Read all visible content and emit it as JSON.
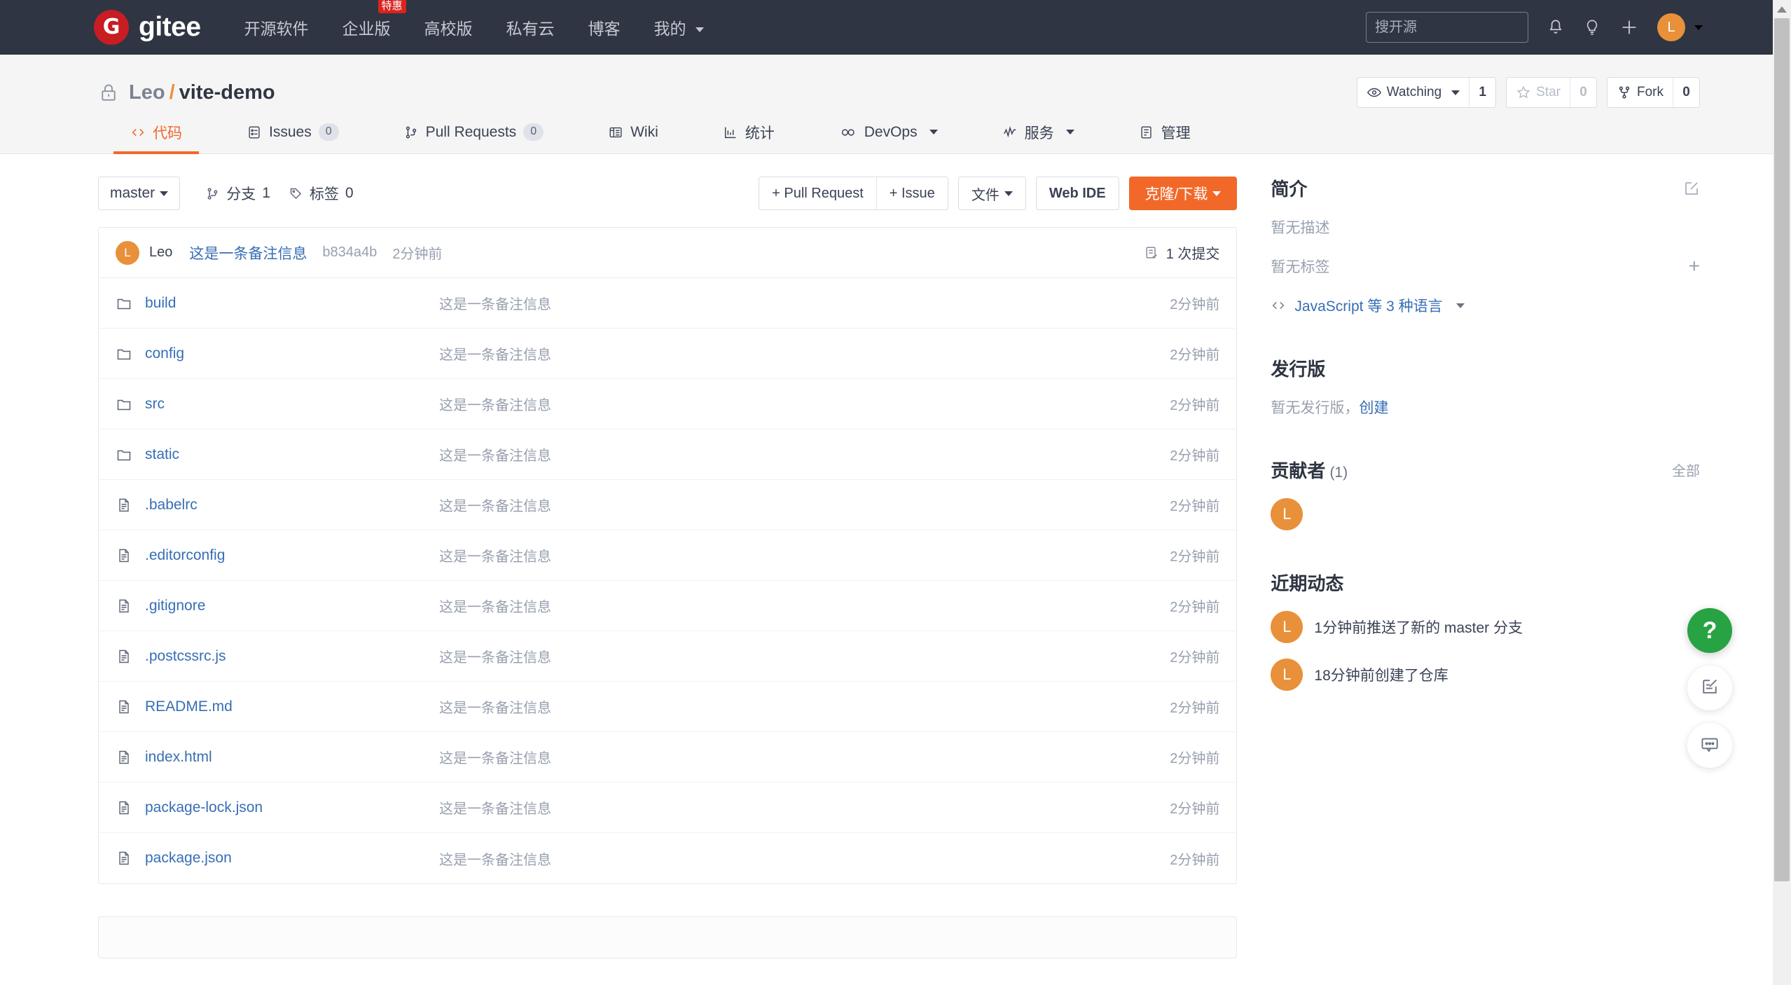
{
  "topnav": {
    "brand_letter": "G",
    "brand_name": "gitee",
    "items": [
      {
        "label": "开源软件",
        "badge": null,
        "caret": false
      },
      {
        "label": "企业版",
        "badge": "特惠",
        "caret": false
      },
      {
        "label": "高校版",
        "badge": null,
        "caret": false
      },
      {
        "label": "私有云",
        "badge": null,
        "caret": false
      },
      {
        "label": "博客",
        "badge": null,
        "caret": false
      },
      {
        "label": "我的",
        "badge": null,
        "caret": true
      }
    ],
    "search_placeholder": "搜开源",
    "search_value": "",
    "avatar_letter": "L"
  },
  "repo": {
    "owner": "Leo",
    "separator": "/",
    "name": "vite-demo",
    "visibility_icon": "lock-icon",
    "watch_label": "Watching",
    "watch_count": "1",
    "star_label": "Star",
    "star_count": "0",
    "fork_label": "Fork",
    "fork_count": "0"
  },
  "tabs": [
    {
      "label": "代码",
      "icon": "code-icon",
      "count": null,
      "active": true,
      "caret": false
    },
    {
      "label": "Issues",
      "icon": "issue-icon",
      "count": "0",
      "active": false,
      "caret": false
    },
    {
      "label": "Pull Requests",
      "icon": "pull-request-icon",
      "count": "0",
      "active": false,
      "caret": false
    },
    {
      "label": "Wiki",
      "icon": "book-icon",
      "count": null,
      "active": false,
      "caret": false
    },
    {
      "label": "统计",
      "icon": "chart-icon",
      "count": null,
      "active": false,
      "caret": false
    },
    {
      "label": "DevOps",
      "icon": "infinity-icon",
      "count": null,
      "active": false,
      "caret": true
    },
    {
      "label": "服务",
      "icon": "pulse-icon",
      "count": null,
      "active": false,
      "caret": true
    },
    {
      "label": "管理",
      "icon": "settings-icon",
      "count": null,
      "active": false,
      "caret": false
    }
  ],
  "toolbar": {
    "branch": "master",
    "branches_label": "分支",
    "branches_count": "1",
    "tags_label": "标签",
    "tags_count": "0",
    "pull_request_label": "+ Pull Request",
    "issue_label": "+ Issue",
    "files_label": "文件",
    "web_ide_label": "Web IDE",
    "clone_label": "克隆/下载"
  },
  "commit": {
    "avatar_letter": "L",
    "author": "Leo",
    "message": "这是一条备注信息",
    "sha": "b834a4b",
    "time": "2分钟前",
    "count_label": "1 次提交"
  },
  "files": [
    {
      "name": "build",
      "type": "folder",
      "message": "这是一条备注信息",
      "time": "2分钟前"
    },
    {
      "name": "config",
      "type": "folder",
      "message": "这是一条备注信息",
      "time": "2分钟前"
    },
    {
      "name": "src",
      "type": "folder",
      "message": "这是一条备注信息",
      "time": "2分钟前"
    },
    {
      "name": "static",
      "type": "folder",
      "message": "这是一条备注信息",
      "time": "2分钟前"
    },
    {
      "name": ".babelrc",
      "type": "file",
      "message": "这是一条备注信息",
      "time": "2分钟前"
    },
    {
      "name": ".editorconfig",
      "type": "file",
      "message": "这是一条备注信息",
      "time": "2分钟前"
    },
    {
      "name": ".gitignore",
      "type": "file",
      "message": "这是一条备注信息",
      "time": "2分钟前"
    },
    {
      "name": ".postcssrc.js",
      "type": "file",
      "message": "这是一条备注信息",
      "time": "2分钟前"
    },
    {
      "name": "README.md",
      "type": "file",
      "message": "这是一条备注信息",
      "time": "2分钟前"
    },
    {
      "name": "index.html",
      "type": "file",
      "message": "这是一条备注信息",
      "time": "2分钟前"
    },
    {
      "name": "package-lock.json",
      "type": "file",
      "message": "这是一条备注信息",
      "time": "2分钟前"
    },
    {
      "name": "package.json",
      "type": "file",
      "message": "这是一条备注信息",
      "time": "2分钟前"
    }
  ],
  "sidebar": {
    "about_title": "简介",
    "no_description": "暂无描述",
    "no_tags": "暂无标签",
    "language_text": "JavaScript 等 3 种语言",
    "releases_title": "发行版",
    "no_releases": "暂无发行版，",
    "create_release": "创建",
    "contributors_title": "贡献者",
    "contributors_count": "(1)",
    "contributors_all": "全部",
    "contributors": [
      {
        "letter": "L"
      }
    ],
    "activity_title": "近期动态",
    "activities": [
      {
        "letter": "L",
        "text": "1分钟前推送了新的 master 分支"
      },
      {
        "letter": "L",
        "text": "18分钟前创建了仓库"
      }
    ]
  },
  "fabs": [
    {
      "name": "help-fab",
      "glyph": "?"
    },
    {
      "name": "feedback-fab",
      "glyph": ""
    },
    {
      "name": "chat-fab",
      "glyph": ""
    }
  ],
  "colors": {
    "navbar_bg": "#2f3542",
    "accent": "#f26829",
    "brand_red": "#c71d23",
    "link_blue": "#376eb5",
    "avatar_orange": "#e8913a",
    "help_green": "#27a343",
    "muted_text": "#98a0af"
  }
}
